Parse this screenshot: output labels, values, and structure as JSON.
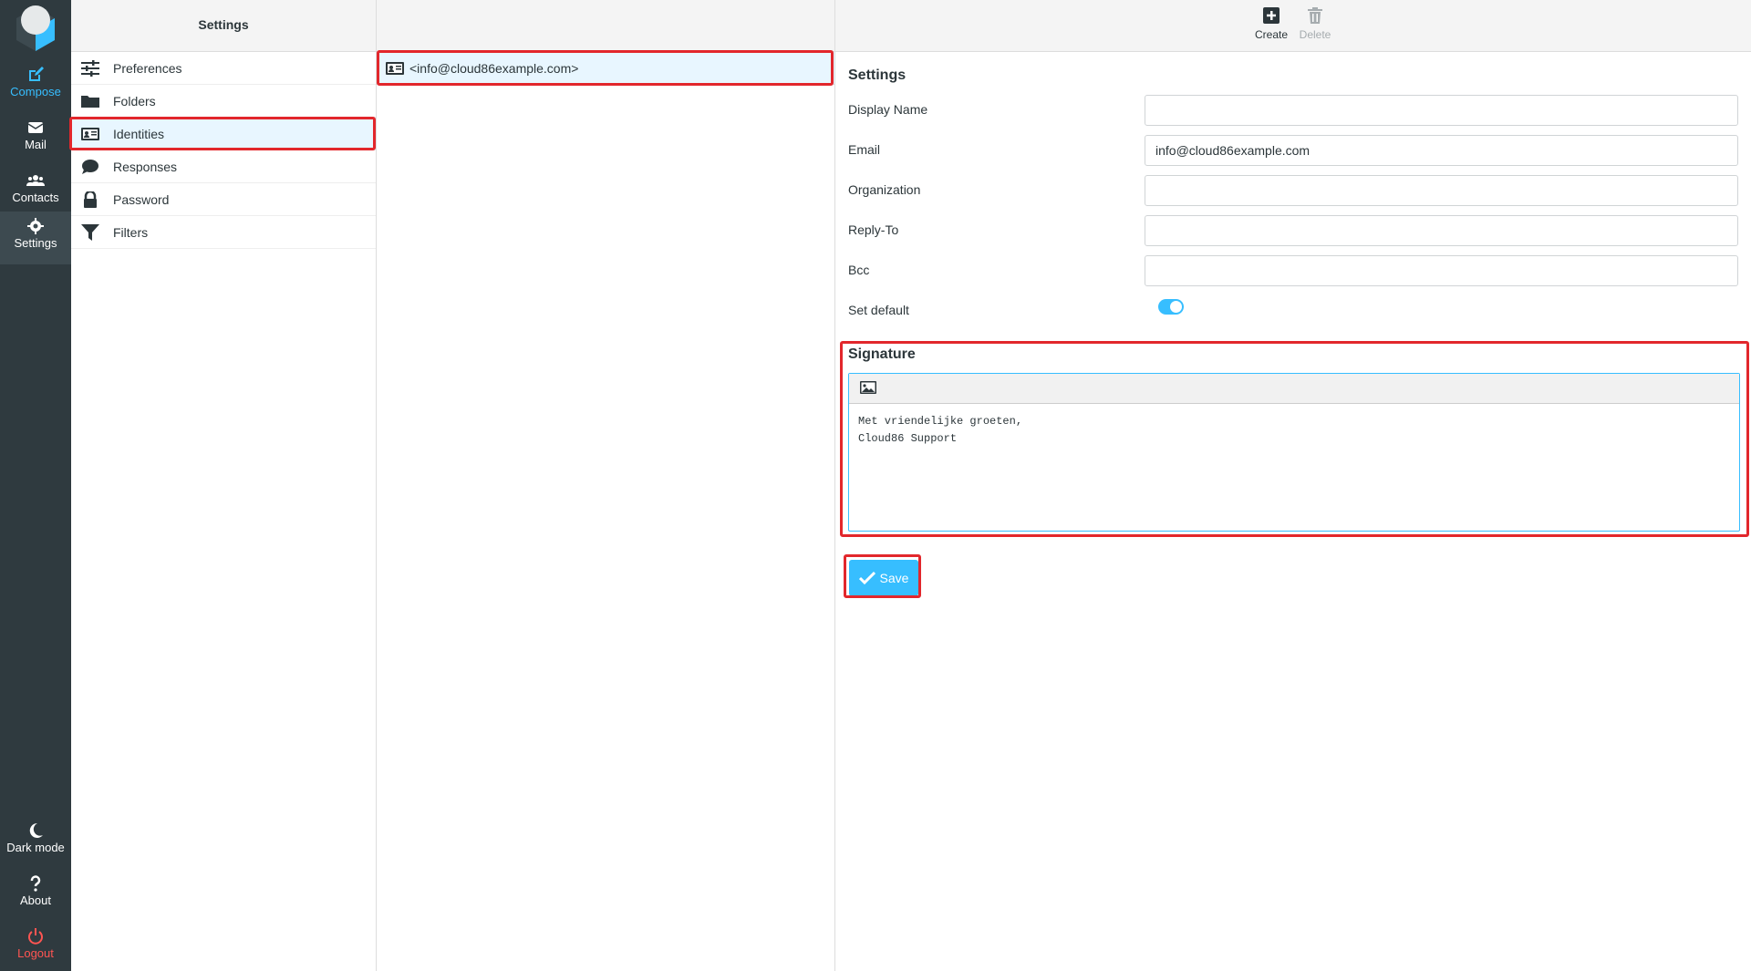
{
  "rail": {
    "compose": "Compose",
    "mail": "Mail",
    "contacts": "Contacts",
    "settings": "Settings",
    "dark_mode": "Dark mode",
    "about": "About",
    "logout": "Logout"
  },
  "settings_panel": {
    "title": "Settings",
    "items": [
      {
        "label": "Preferences",
        "icon": "sliders-icon"
      },
      {
        "label": "Folders",
        "icon": "folder-icon"
      },
      {
        "label": "Identities",
        "icon": "id-card-icon"
      },
      {
        "label": "Responses",
        "icon": "comment-icon"
      },
      {
        "label": "Password",
        "icon": "lock-icon"
      },
      {
        "label": "Filters",
        "icon": "filter-icon"
      }
    ],
    "active_index": 2
  },
  "identities": {
    "items": [
      {
        "label": "<info@cloud86example.com>"
      }
    ]
  },
  "toolbar": {
    "create": "Create",
    "delete": "Delete"
  },
  "form": {
    "title": "Settings",
    "display_name": {
      "label": "Display Name",
      "value": ""
    },
    "email": {
      "label": "Email",
      "value": "info@cloud86example.com"
    },
    "organization": {
      "label": "Organization",
      "value": ""
    },
    "reply_to": {
      "label": "Reply-To",
      "value": ""
    },
    "bcc": {
      "label": "Bcc",
      "value": ""
    },
    "set_default": {
      "label": "Set default",
      "checked": true
    }
  },
  "signature": {
    "title": "Signature",
    "text": "Met vriendelijke groeten,\nCloud86 Support"
  },
  "save_label": "Save",
  "colors": {
    "rail_bg": "#2f3a3f",
    "accent": "#37beff",
    "highlight": "#e2272c",
    "logout": "#ff5552"
  }
}
